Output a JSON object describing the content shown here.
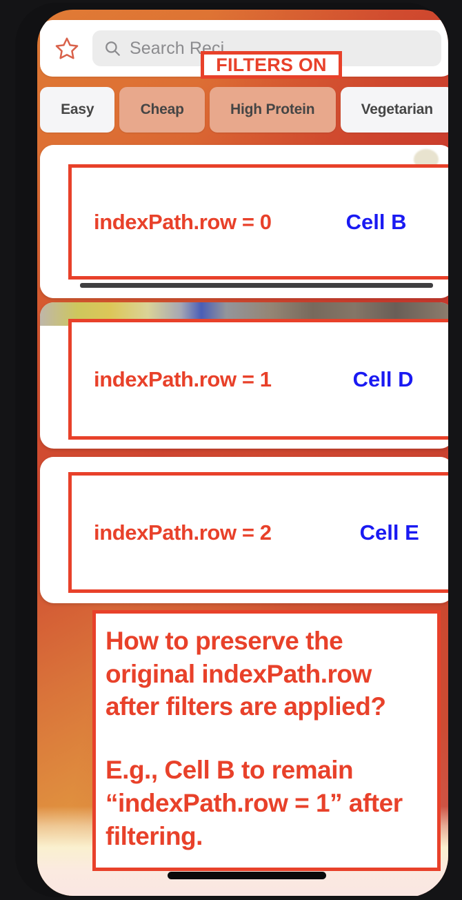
{
  "app": {
    "platform": "iOS",
    "home_indicator": true
  },
  "search": {
    "star_icon": "star-outline-icon",
    "search_icon": "search-icon",
    "placeholder": "Search Reci",
    "value": ""
  },
  "filters": {
    "chips": [
      {
        "label": "Easy",
        "active": false
      },
      {
        "label": "Cheap",
        "active": true
      },
      {
        "label": "High Protein",
        "active": true
      },
      {
        "label": "Vegetarian",
        "active": false
      }
    ],
    "badge_label": "FILTERS ON"
  },
  "list": {
    "rows": [
      {
        "index_label": "indexPath.row = 0",
        "cell_label": "Cell B"
      },
      {
        "index_label": "indexPath.row = 1",
        "cell_label": "Cell D"
      },
      {
        "index_label": "indexPath.row = 2",
        "cell_label": "Cell E"
      }
    ]
  },
  "question": {
    "paragraph_1": "How to preserve the original indexPath.row after filters are applied?",
    "paragraph_2": "E.g., Cell B to remain “indexPath.row = 1” after filtering."
  },
  "colors": {
    "annotation_red": "#e8412a",
    "cell_blue": "#1a1af2",
    "chip_active": "#e8a88c",
    "chip_inactive": "#f5f5f7",
    "background_top_left": "#e07b35",
    "background_top_right": "#cf4630",
    "background_bottom": "#fcf6dd"
  }
}
